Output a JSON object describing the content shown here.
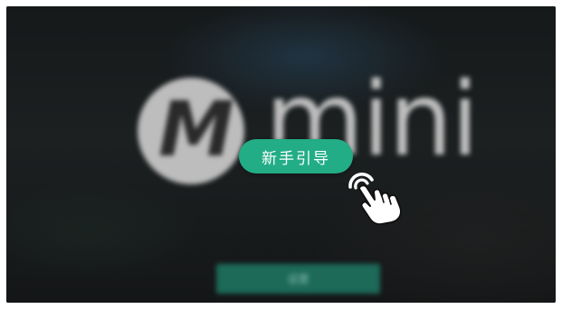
{
  "logo": {
    "monogram": "M",
    "wordmark": "mini"
  },
  "background_button": {
    "label": "设置"
  },
  "guide": {
    "label": "新手引导"
  },
  "icons": {
    "tap_hand": "hand-tap-icon"
  },
  "colors": {
    "accent": "#22ad86",
    "background": "#171a1b",
    "logo_gray": "#bdbdbd"
  }
}
